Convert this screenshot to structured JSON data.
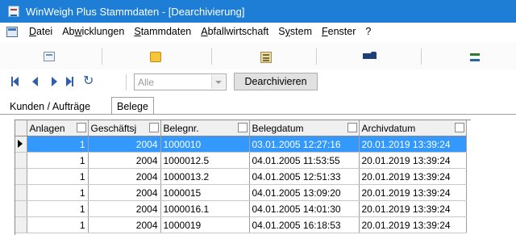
{
  "window": {
    "title": "WinWeigh Plus Stammdaten - [Dearchivierung]"
  },
  "menu": {
    "items": [
      {
        "ul": "D",
        "rest": "atei"
      },
      {
        "pre": "Ab",
        "ul": "w",
        "rest": "icklungen"
      },
      {
        "ul": "S",
        "rest": "tammdaten"
      },
      {
        "ul": "A",
        "rest": "bfallwirtschaft"
      },
      {
        "pre": "S",
        "ul": "y",
        "rest": "stem"
      },
      {
        "ul": "F",
        "rest": "enster"
      },
      {
        "pre": "?",
        "ul": "",
        "rest": ""
      }
    ]
  },
  "toolbar": {
    "icons": [
      "form-icon",
      "box-icon",
      "calculator-icon",
      "truck-icon",
      "exchange-arrows-icon"
    ],
    "filter": {
      "value": "Alle"
    },
    "dearchive_label": "Dearchivieren"
  },
  "tabs": {
    "kunden": "Kunden / Aufträge",
    "belege": "Belege"
  },
  "grid": {
    "headers": {
      "anlagen": "Anlagen",
      "geschaeftsj": "Geschäftsj",
      "belegnr": "Belegnr.",
      "belegdatum": "Belegdatum",
      "archivdatum": "Archivdatum"
    },
    "rows": [
      {
        "anlagen": "1",
        "geschaeftsj": "2004",
        "belegnr": "1000010",
        "belegdatum": "03.01.2005 12:27:16",
        "archivdatum": "20.01.2019 13:39:24"
      },
      {
        "anlagen": "1",
        "geschaeftsj": "2004",
        "belegnr": "1000012.5",
        "belegdatum": "04.01.2005 11:53:55",
        "archivdatum": "20.01.2019 13:39:24"
      },
      {
        "anlagen": "1",
        "geschaeftsj": "2004",
        "belegnr": "1000013.2",
        "belegdatum": "04.01.2005 12:51:33",
        "archivdatum": "20.01.2019 13:39:24"
      },
      {
        "anlagen": "1",
        "geschaeftsj": "2004",
        "belegnr": "1000015",
        "belegdatum": "04.01.2005 13:09:20",
        "archivdatum": "20.01.2019 13:39:24"
      },
      {
        "anlagen": "1",
        "geschaeftsj": "2004",
        "belegnr": "1000016.1",
        "belegdatum": "04.01.2005 14:01:30",
        "archivdatum": "20.01.2019 13:39:24"
      },
      {
        "anlagen": "1",
        "geschaeftsj": "2004",
        "belegnr": "1000019",
        "belegdatum": "04.01.2005 16:18:53",
        "archivdatum": "20.01.2019 13:39:24"
      }
    ]
  }
}
